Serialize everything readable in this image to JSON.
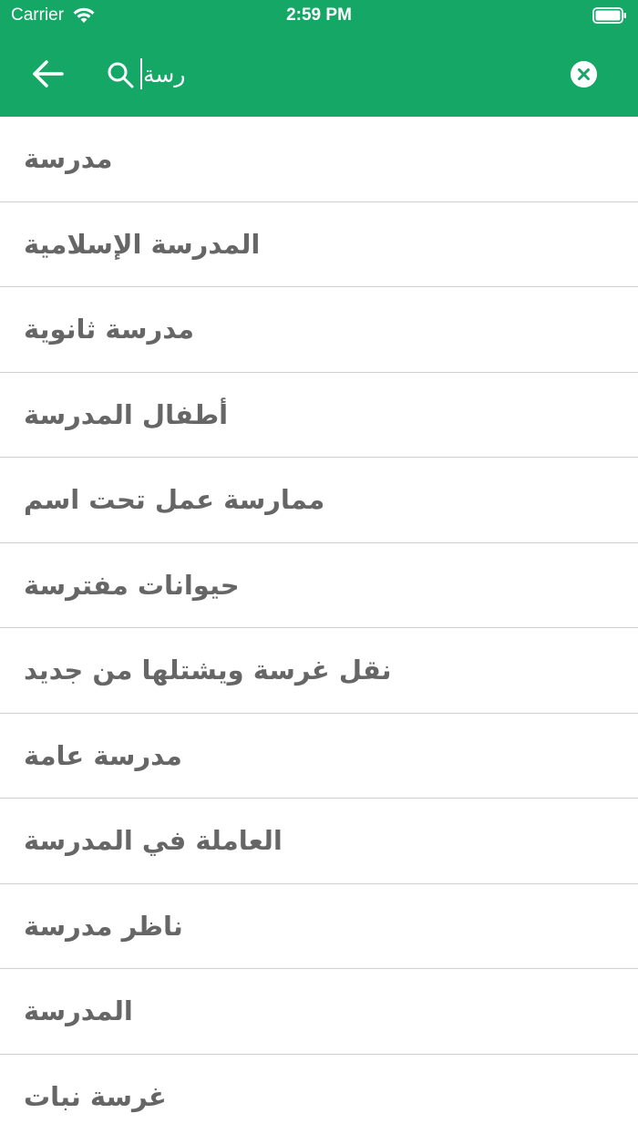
{
  "status_bar": {
    "carrier": "Carrier",
    "time": "2:59 PM"
  },
  "search": {
    "query": "رسة"
  },
  "colors": {
    "header": "#15a765",
    "item_text": "#666666",
    "divider": "#cfcfcf"
  },
  "icons": {
    "back": "arrow-left-icon",
    "search": "search-icon",
    "clear": "clear-icon",
    "wifi": "wifi-icon",
    "battery": "battery-icon"
  },
  "results": [
    {
      "text": "مدرسة"
    },
    {
      "text": "المدرسة الإسلامية"
    },
    {
      "text": "مدرسة ثانوية"
    },
    {
      "text": "أطفال المدرسة"
    },
    {
      "text": "ممارسة عمل تحت اسم"
    },
    {
      "text": "حيوانات مفترسة"
    },
    {
      "text": "نقل غرسة ويشتلها من جديد"
    },
    {
      "text": "مدرسة عامة"
    },
    {
      "text": "العاملة في المدرسة"
    },
    {
      "text": "ناظر مدرسة"
    },
    {
      "text": "المدرسة"
    },
    {
      "text": "غرسة نبات"
    }
  ]
}
